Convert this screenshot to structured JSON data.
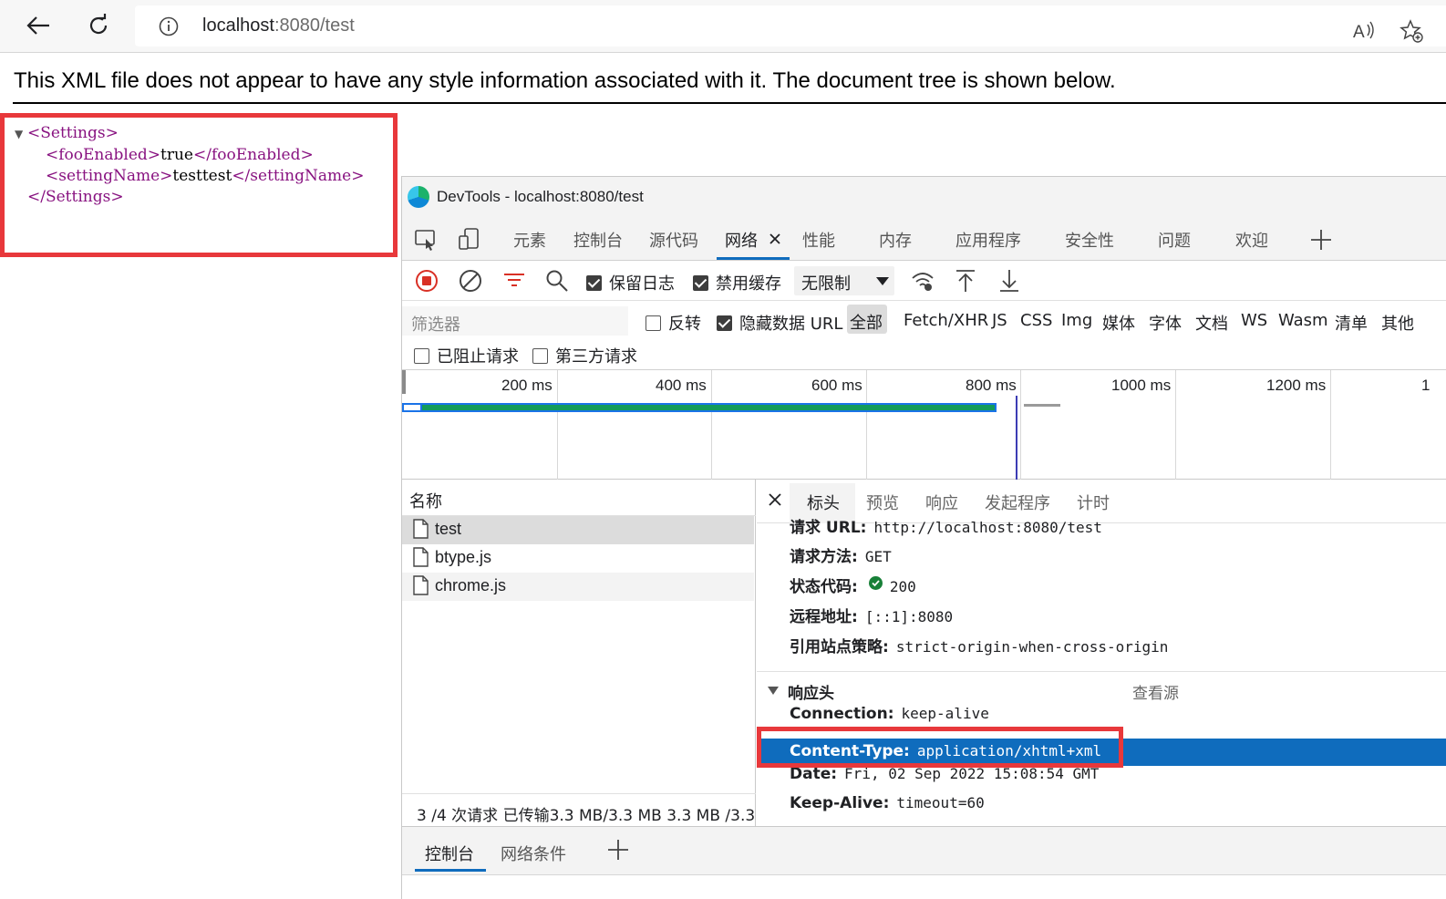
{
  "browser": {
    "url_host": "localhost",
    "url_rest": ":8080/test"
  },
  "xml_page": {
    "notice": "This XML file does not appear to have any style information associated with it. The document tree is shown below.",
    "tree": {
      "root_open": "<Settings>",
      "line1_open": "<fooEnabled>",
      "line1_text": "true",
      "line1_close": "</fooEnabled>",
      "line2_open": "<settingName>",
      "line2_text": "testtest",
      "line2_close": "</settingName>",
      "root_close": "</Settings>"
    }
  },
  "devtools": {
    "title": "DevTools - localhost:8080/test",
    "tabs": [
      "元素",
      "控制台",
      "源代码",
      "网络",
      "性能",
      "内存",
      "应用程序",
      "安全性",
      "问题",
      "欢迎"
    ],
    "toolbar": {
      "preserve_log": "保留日志",
      "disable_cache": "禁用缓存",
      "throttle": "无限制"
    },
    "filter": {
      "placeholder": "筛选器",
      "invert": "反转",
      "hide_data_url": "隐藏数据 URL",
      "all": "全部",
      "types": [
        "Fetch/XHR",
        "JS",
        "CSS",
        "Img",
        "媒体",
        "字体",
        "文档",
        "WS",
        "Wasm",
        "清单",
        "其他"
      ],
      "blocked": "已阻止请求",
      "third_party": "第三方请求"
    },
    "timeline": {
      "ticks": [
        "200 ms",
        "400 ms",
        "600 ms",
        "800 ms",
        "1000 ms",
        "1200 ms",
        "1"
      ]
    },
    "requests": {
      "header": "名称",
      "items": [
        "test",
        "btype.js",
        "chrome.js"
      ],
      "status": "3 /4 次请求  已传输3.3 MB/3.3 MB  3.3 MB /3.3"
    },
    "detail": {
      "tabs": [
        "标头",
        "预览",
        "响应",
        "发起程序",
        "计时"
      ],
      "general": [
        {
          "key": "请求 URL:",
          "value": "http://localhost:8080/test"
        },
        {
          "key": "请求方法:",
          "value": "GET"
        },
        {
          "key": "状态代码:",
          "value": "200"
        },
        {
          "key": "远程地址:",
          "value": "[::1]:8080"
        },
        {
          "key": "引用站点策略:",
          "value": "strict-origin-when-cross-origin"
        }
      ],
      "response_headers_title": "响应头",
      "view_source": "查看源",
      "response_headers": [
        {
          "key": "Connection:",
          "value": "keep-alive"
        },
        {
          "key": "Content-Type:",
          "value": "application/xhtml+xml"
        },
        {
          "key": "Date:",
          "value": "Fri, 02 Sep 2022 15:08:54 GMT"
        },
        {
          "key": "Keep-Alive:",
          "value": "timeout=60"
        }
      ]
    },
    "drawer": {
      "tabs": [
        "控制台",
        "网络条件"
      ]
    }
  },
  "colors": {
    "highlight_border": "#e8383b",
    "selected_row": "#0f6cbd",
    "xml_tag": "#881280"
  }
}
